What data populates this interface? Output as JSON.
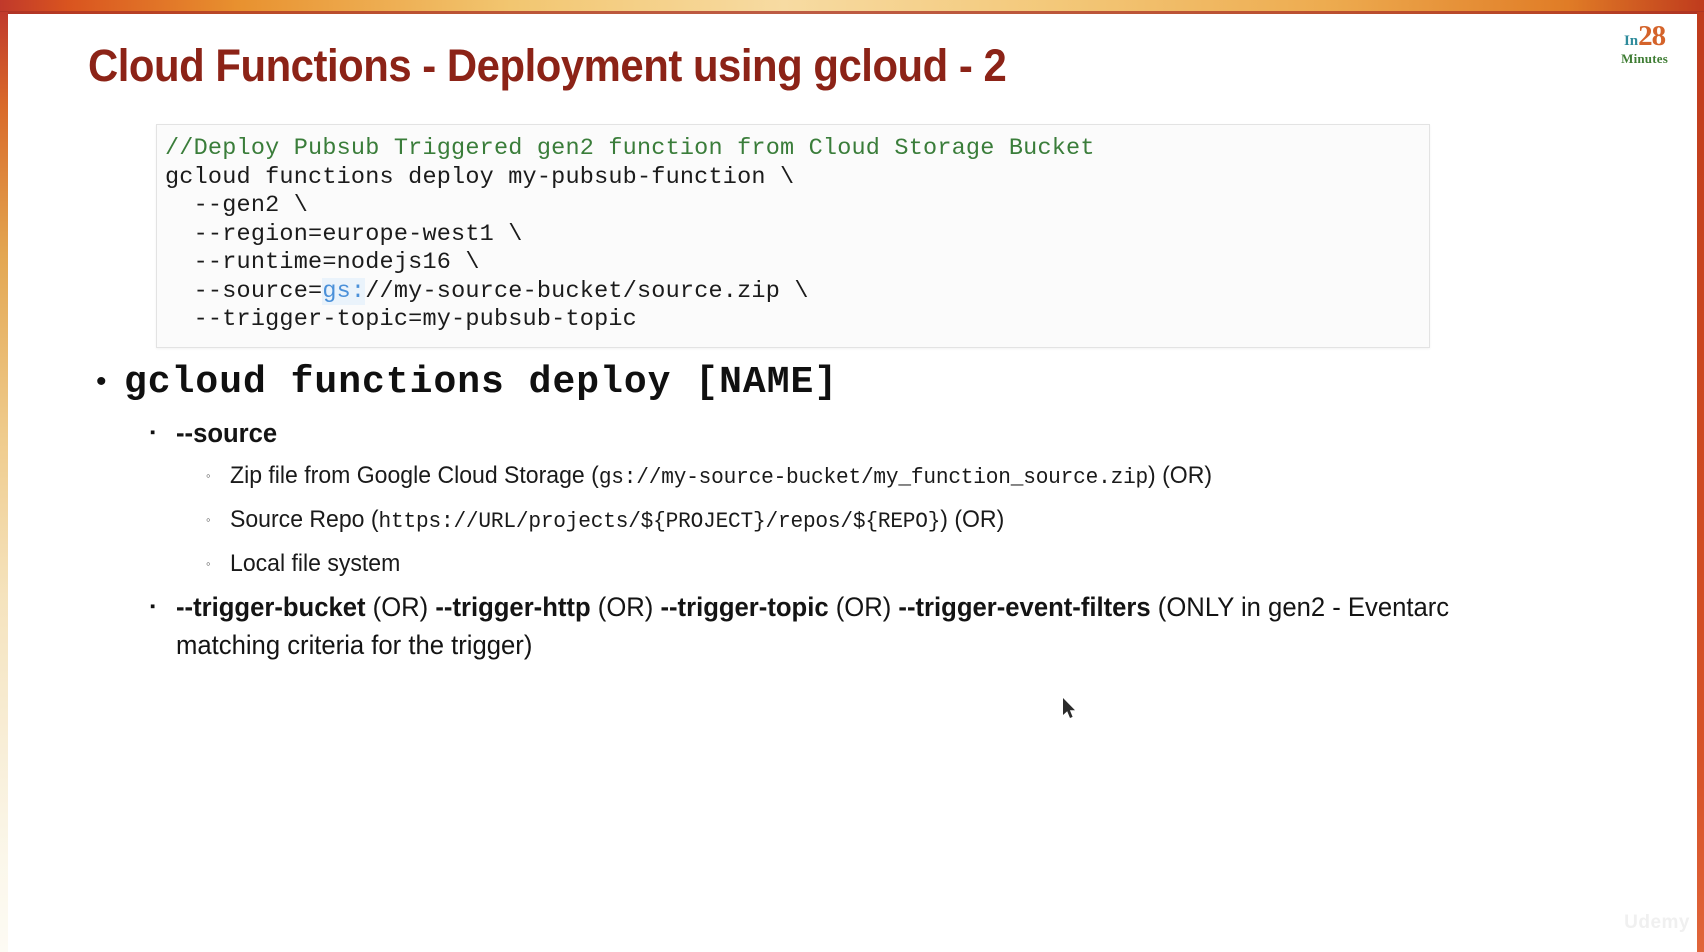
{
  "slide": {
    "title": "Cloud Functions - Deployment using gcloud - 2",
    "title_color": "#8c2317"
  },
  "logo": {
    "in": "In",
    "num": "28",
    "minutes": "Minutes",
    "in_color": "#2e8b9b",
    "num_color": "#d4632a",
    "minutes_color": "#3f7d34"
  },
  "code_block": {
    "comment": "//Deploy Pubsub Triggered gen2 function from Cloud Storage Bucket",
    "comment_color": "#3a7d3a",
    "lines": [
      "gcloud functions deploy my-pubsub-function \\",
      "  --gen2 \\",
      "  --region=europe-west1 \\",
      "  --runtime=nodejs16 \\"
    ],
    "source_line_prefix": "  --source=",
    "source_line_scheme": "gs:",
    "source_line_rest": "//my-source-bucket/source.zip \\",
    "scheme_color": "#4a90d9",
    "last_line": "  --trigger-topic=my-pubsub-topic"
  },
  "bullets": {
    "level1": {
      "marker": "•",
      "text": "gcloud functions deploy [NAME]"
    },
    "source": {
      "marker": "▪",
      "label": "--source",
      "items": [
        {
          "marker": "◦",
          "prefix": "Zip file from Google Cloud Storage (",
          "mono": "gs://my-source-bucket/my_function_source.zip",
          "suffix": ") (OR)"
        },
        {
          "marker": "◦",
          "prefix": "Source Repo (",
          "mono": "https://URL/projects/${PROJECT}/repos/${REPO}",
          "suffix": ") (OR)"
        },
        {
          "marker": "◦",
          "prefix": "Local file system",
          "mono": "",
          "suffix": ""
        }
      ]
    },
    "triggers": {
      "marker": "▪",
      "opt1": "--trigger-bucket",
      "sep1": " (OR) ",
      "opt2": "--trigger-http",
      "sep2": " (OR) ",
      "opt3": "--trigger-topic",
      "sep3": " (OR) ",
      "opt4": "--trigger-event-filters",
      "note": " (ONLY in gen2 - Eventarc matching criteria for the trigger)"
    }
  },
  "watermark": {
    "text": "Udemy"
  }
}
